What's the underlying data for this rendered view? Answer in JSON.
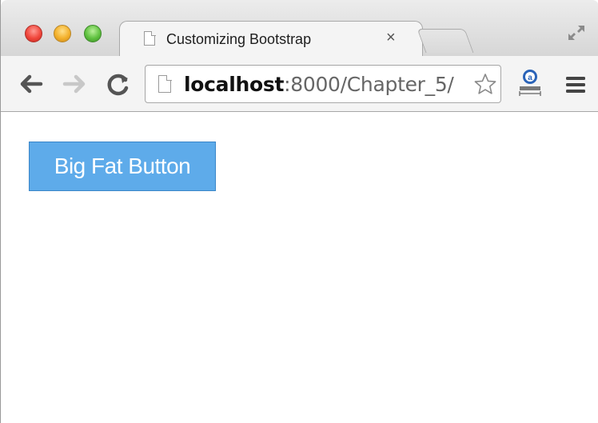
{
  "window": {
    "traffic_lights": [
      "close",
      "minimize",
      "zoom"
    ],
    "colors": {
      "close": "#f0463b",
      "minimize": "#f3b02a",
      "zoom": "#5fc13f"
    }
  },
  "tab": {
    "title": "Customizing Bootstrap",
    "close_label": "×",
    "icon": "page-icon"
  },
  "toolbar": {
    "back_icon": "back-arrow-icon",
    "forward_icon": "forward-arrow-icon",
    "reload_icon": "reload-icon",
    "menu_icon": "hamburger-menu-icon",
    "extension_icon": "extension-icon",
    "bookmark_icon": "star-icon"
  },
  "omnibox": {
    "host": "localhost",
    "path": ":8000/Chapter_5/"
  },
  "page": {
    "button_label": "Big Fat Button",
    "button_color": "#5eabea"
  }
}
